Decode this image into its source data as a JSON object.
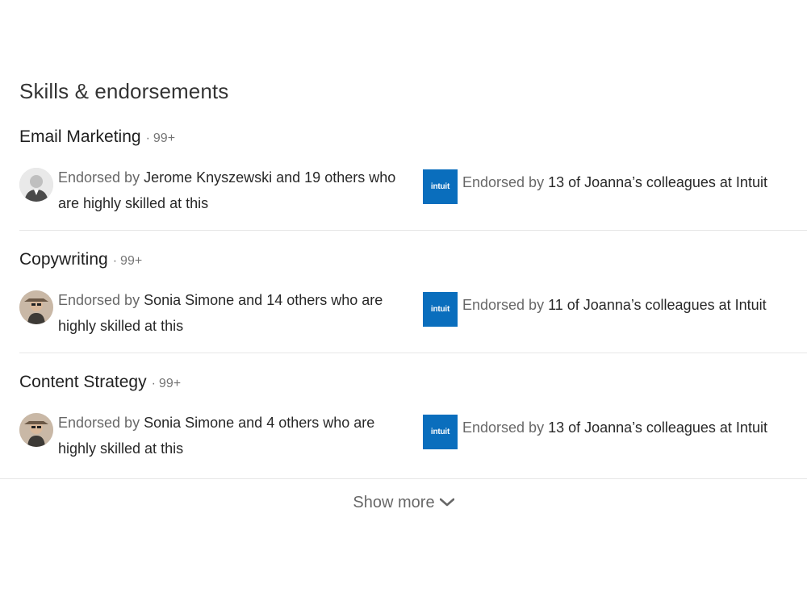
{
  "section": {
    "title": "Skills & endorsements"
  },
  "skills": [
    {
      "name": "Email Marketing",
      "separator": "·",
      "count": "99+",
      "endorsed_by_prefix": "Endorsed by",
      "endorser_line": "Jerome Knyszewski and 19 others who",
      "endorser_line2": "are highly skilled at this",
      "avatar_icon": "person-avatar-icon",
      "company_logo": "intuit",
      "company_prefix": "Endorsed by",
      "company_text": "13 of Joanna’s colleagues at Intuit"
    },
    {
      "name": "Copywriting",
      "separator": "·",
      "count": "99+",
      "endorsed_by_prefix": "Endorsed by",
      "endorser_line": "Sonia Simone and 14 others who are",
      "endorser_line2": "highly skilled at this",
      "avatar_icon": "person-avatar-icon",
      "company_logo": "intuit",
      "company_prefix": "Endorsed by",
      "company_text": "11 of Joanna’s colleagues at Intuit"
    },
    {
      "name": "Content Strategy",
      "separator": "·",
      "count": "99+",
      "endorsed_by_prefix": "Endorsed by",
      "endorser_line": "Sonia Simone and 4 others who are",
      "endorser_line2": "highly skilled at this",
      "avatar_icon": "person-avatar-icon",
      "company_logo": "intuit",
      "company_prefix": "Endorsed by",
      "company_text": "13 of Joanna’s colleagues at Intuit"
    }
  ],
  "show_more": {
    "label": "Show more",
    "icon": "chevron-down-icon"
  },
  "colors": {
    "intuit_blue": "#0a6ebd",
    "divider": "#e6e6e6"
  }
}
